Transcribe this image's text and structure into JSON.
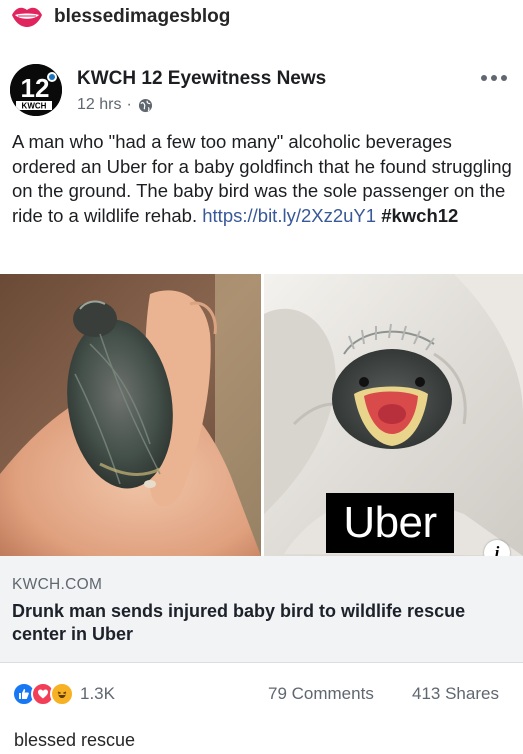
{
  "blog": {
    "name": "blessedimagesblog",
    "logo_icon": "lips-logo-icon"
  },
  "post": {
    "page_name": "KWCH 12 Eyewitness News",
    "avatar_text": "12",
    "avatar_subtext": "KWCH",
    "time": "12 hrs",
    "separator": "·",
    "privacy_icon": "globe-icon",
    "more_icon": "more-options-icon",
    "text_body": "A man who \"had a few too many\" alcoholic beverages ordered an Uber for a baby goldfinch that he found struggling on the ground. The baby bird was the sole passenger on the ride to a wildlife rehab. ",
    "text_link": "https://bit.ly/2Xz2uY1",
    "text_hashtag": "#kwch12"
  },
  "images": {
    "left_icon": "baby-bird-in-hand-image",
    "right_icon": "baby-bird-mouth-open-image",
    "badge": "Uber",
    "info_label": "i"
  },
  "link_card": {
    "domain": "KWCH.COM",
    "title": "Drunk man sends injured baby bird to wildlife rescue center in Uber"
  },
  "footer": {
    "reaction_icons": [
      "like-icon",
      "love-icon",
      "haha-icon"
    ],
    "reaction_count": "1.3K",
    "comments": "79 Comments",
    "shares": "413 Shares"
  },
  "caption": "blessed rescue",
  "colors": {
    "link": "#385898",
    "meta": "#606770",
    "like": "#1877f2",
    "love": "#f33e58",
    "haha": "#f7b125",
    "uber": "#000000"
  }
}
